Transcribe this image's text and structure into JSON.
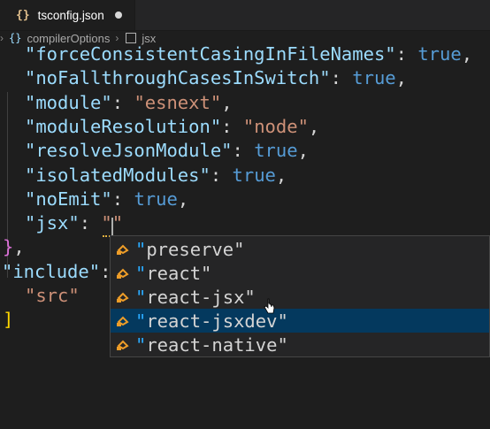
{
  "tab": {
    "icon_text": "{}",
    "filename": "tsconfig.json"
  },
  "breadcrumb": {
    "braces": "{}",
    "item1": "compilerOptions",
    "item2": "jsx"
  },
  "lines": [
    {
      "key": "\"forceConsistentCasingInFileNames\"",
      "colon": ": ",
      "value": "true",
      "comma": ","
    },
    {
      "key": "\"noFallthroughCasesInSwitch\"",
      "colon": ": ",
      "value": "true",
      "comma": ","
    },
    {
      "key": "\"module\"",
      "colon": ": ",
      "value": "\"esnext\"",
      "comma": ","
    },
    {
      "key": "\"moduleResolution\"",
      "colon": ": ",
      "value": "\"node\"",
      "comma": ","
    },
    {
      "key": "\"resolveJsonModule\"",
      "colon": ": ",
      "value": "true",
      "comma": ","
    },
    {
      "key": "\"isolatedModules\"",
      "colon": ": ",
      "value": "true",
      "comma": ","
    },
    {
      "key": "\"noEmit\"",
      "colon": ": ",
      "value": "true",
      "comma": ","
    },
    {
      "key": "\"jsx\"",
      "colon": ": ",
      "value": "\"\"",
      "comma": ""
    }
  ],
  "closing": {
    "brace": "}",
    "comma": ","
  },
  "include": {
    "key": "\"include\"",
    "colon": ":",
    "bracket": "[",
    "item": "\"src\"",
    "close": "]"
  },
  "suggestions": {
    "icon": "symbol-property-icon",
    "items": [
      {
        "prefix": "\"",
        "rest": "preserve\""
      },
      {
        "prefix": "\"",
        "rest": "react\""
      },
      {
        "prefix": "\"",
        "rest": "react-jsx\""
      },
      {
        "prefix": "\"",
        "rest": "react-jsxdev\""
      },
      {
        "prefix": "\"",
        "rest": "react-native\""
      }
    ],
    "selected_index": 3
  },
  "colors": {
    "key": "#9cdcfe",
    "string": "#ce9178",
    "boolean": "#569cd6",
    "highlight": "#2aaaff",
    "selection": "#04395e",
    "icon": "#ee9d28"
  }
}
